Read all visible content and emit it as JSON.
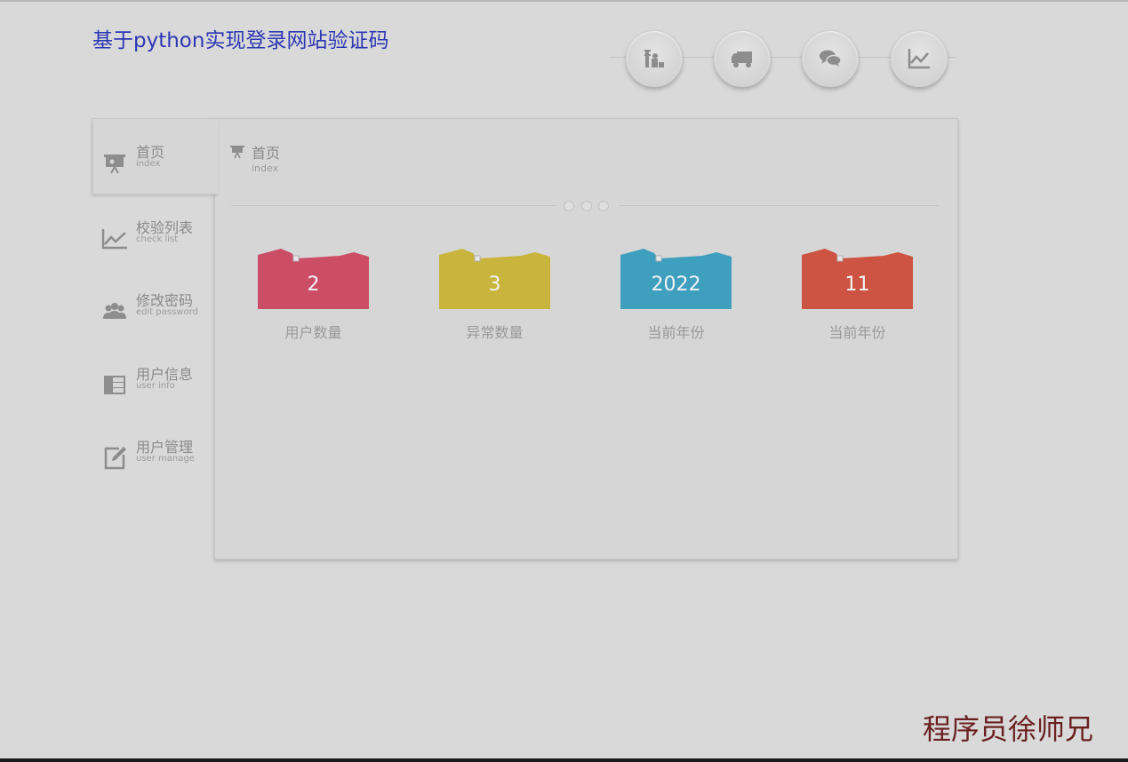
{
  "header": {
    "title": "基于python实现登录网站验证码"
  },
  "top_nav": {
    "icons": [
      {
        "name": "stats-icon"
      },
      {
        "name": "truck-icon"
      },
      {
        "name": "chat-icon"
      },
      {
        "name": "line-chart-icon"
      }
    ]
  },
  "sidebar": {
    "items": [
      {
        "label": "首页",
        "sub": "index"
      },
      {
        "label": "校验列表",
        "sub": "check list"
      },
      {
        "label": "修改密码",
        "sub": "edit password"
      },
      {
        "label": "用户信息",
        "sub": "user info"
      },
      {
        "label": "用户管理",
        "sub": "user manage"
      }
    ]
  },
  "main": {
    "title": "首页",
    "subtitle": "index",
    "cards": [
      {
        "value": "2",
        "caption": "用户数量",
        "color": "#cc4d66"
      },
      {
        "value": "3",
        "caption": "异常数量",
        "color": "#c9b53e"
      },
      {
        "value": "2022",
        "caption": "当前年份",
        "color": "#3f9fbf"
      },
      {
        "value": "11",
        "caption": "当前年份",
        "color": "#cd5342"
      }
    ]
  },
  "watermark": "程序员徐师兄",
  "colors": {
    "title": "#2d37b3",
    "background": "#d9d9d9",
    "text_muted": "#8a8a8a"
  }
}
